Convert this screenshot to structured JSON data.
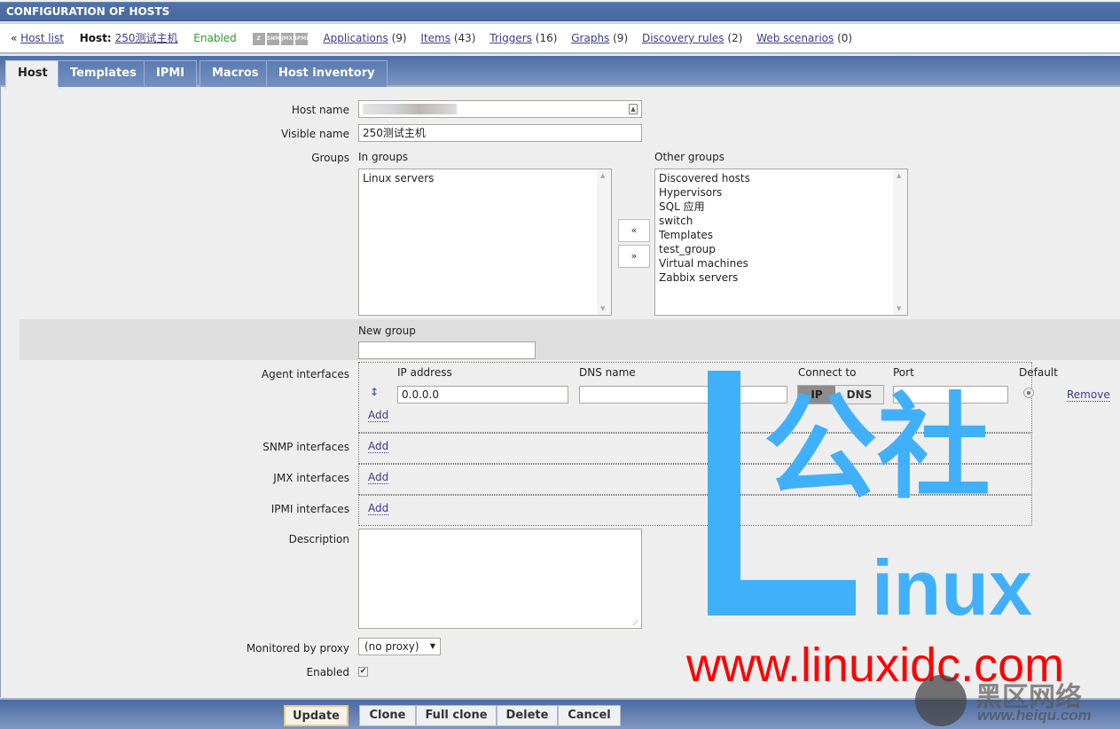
{
  "page": {
    "title": "CONFIGURATION OF HOSTS"
  },
  "nav": {
    "back_glyph": "«",
    "host_list": "Host list",
    "host_label": "Host:",
    "host_name": "250测试主机",
    "status": "Enabled",
    "interface_icons": [
      "Z",
      "SNMP",
      "JMX",
      "IPMI"
    ],
    "links": [
      {
        "label": "Applications",
        "count": "(9)"
      },
      {
        "label": "Items",
        "count": "(43)"
      },
      {
        "label": "Triggers",
        "count": "(16)"
      },
      {
        "label": "Graphs",
        "count": "(9)"
      },
      {
        "label": "Discovery rules",
        "count": "(2)"
      },
      {
        "label": "Web scenarios",
        "count": "(0)"
      }
    ]
  },
  "tabs": [
    {
      "label": "Host",
      "active": true
    },
    {
      "label": "Templates",
      "active": false
    },
    {
      "label": "IPMI",
      "active": false
    },
    {
      "label": "Macros",
      "active": false
    },
    {
      "label": "Host inventory",
      "active": false
    }
  ],
  "form": {
    "host_name_label": "Host name",
    "host_name_value": "",
    "visible_name_label": "Visible name",
    "visible_name_value": "250测试主机",
    "groups_label": "Groups",
    "in_groups_label": "In groups",
    "in_groups": [
      "Linux servers"
    ],
    "other_groups_label": "Other groups",
    "other_groups": [
      "Discovered hosts",
      "Hypervisors",
      "SQL 应用",
      "switch",
      "Templates",
      "test_group",
      "Virtual machines",
      "Zabbix servers"
    ],
    "move_left": "«",
    "move_right": "»",
    "new_group_label": "New group",
    "new_group_value": "",
    "agent_interfaces_label": "Agent interfaces",
    "col_ip": "IP address",
    "col_dns": "DNS name",
    "col_connect": "Connect to",
    "col_port": "Port",
    "col_default": "Default",
    "agent_ip": "0.0.0.0",
    "agent_dns": "",
    "connect_ip": "IP",
    "connect_dns": "DNS",
    "connect_selected": "IP",
    "agent_port": "0",
    "remove": "Remove",
    "add": "Add",
    "snmp_label": "SNMP interfaces",
    "jmx_label": "JMX interfaces",
    "ipmi_label": "IPMI interfaces",
    "description_label": "Description",
    "description_value": "",
    "proxy_label": "Monitored by proxy",
    "proxy_value": "(no proxy)",
    "enabled_label": "Enabled",
    "enabled_checked": true
  },
  "footer": {
    "update": "Update",
    "clone": "Clone",
    "full_clone": "Full clone",
    "delete": "Delete",
    "cancel": "Cancel"
  },
  "watermark": {
    "cn": "公社",
    "inux": "inux",
    "url": "www.linuxidc.com",
    "heiqu_cn": "黑区网络",
    "heiqu_url": "www.heiqu.com"
  },
  "colors": {
    "header_blue": "#4f72a9",
    "link": "#3c3c8c",
    "enabled_green": "#2e9c2e",
    "watermark_blue": "#41b0fb",
    "watermark_red": "#ff0000"
  }
}
